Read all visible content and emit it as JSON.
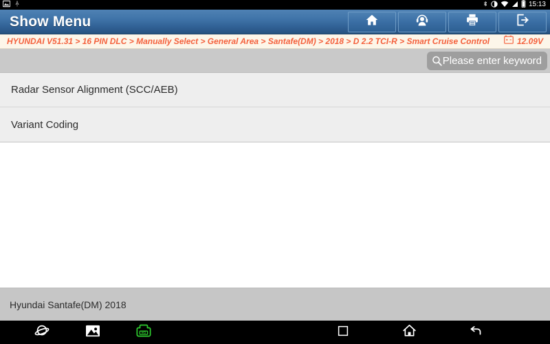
{
  "status_bar": {
    "left_icons": [
      "gallery-icon",
      "usb-icon"
    ],
    "right_icons": [
      "bluetooth-icon",
      "dnd-icon",
      "wifi-icon",
      "signal-icon",
      "battery-icon"
    ],
    "time": "15:13"
  },
  "title_bar": {
    "title": "Show Menu",
    "buttons": [
      {
        "name": "home-button",
        "icon": "home-icon"
      },
      {
        "name": "support-button",
        "icon": "headset-person-icon"
      },
      {
        "name": "print-button",
        "icon": "printer-icon"
      },
      {
        "name": "exit-button",
        "icon": "exit-door-icon"
      }
    ]
  },
  "breadcrumb": {
    "path": "HYUNDAI V51.31 > 16 PIN DLC > Manually Select > General Area > Santafe(DM) > 2018 > D 2.2 TCI-R > Smart Cruise Control",
    "segments": [
      "HYUNDAI V51.31",
      "16 PIN DLC",
      "Manually Select",
      "General Area",
      "Santafe(DM)",
      "2018",
      "D 2.2 TCI-R",
      "Smart Cruise Control"
    ],
    "voltage": "12.09V",
    "voltage_icon": "car-battery-icon"
  },
  "search": {
    "placeholder": "Please enter keyword",
    "value": "",
    "icon": "search-icon"
  },
  "menu": {
    "items": [
      {
        "label": "Radar Sensor Alignment (SCC/AEB)"
      },
      {
        "label": "Variant Coding"
      }
    ]
  },
  "footer": {
    "vehicle": "Hyundai Santafe(DM) 2018"
  },
  "nav_bar": {
    "left_buttons": [
      {
        "name": "browser-button",
        "icon": "planet-icon"
      },
      {
        "name": "gallery-button",
        "icon": "image-icon"
      },
      {
        "name": "vci-button",
        "icon": "vci-connector-icon",
        "label": "VCI"
      }
    ],
    "right_buttons": [
      {
        "name": "recents-button",
        "icon": "square-icon"
      },
      {
        "name": "home-button",
        "icon": "home-outline-icon"
      },
      {
        "name": "back-button",
        "icon": "back-arrow-icon"
      }
    ]
  },
  "colors": {
    "title_bar_blue": "#3a6ea4",
    "breadcrumb_orange": "#f4603c",
    "breadcrumb_bg": "#fdf6e9",
    "search_band_gray": "#c9c9c9",
    "list_item_gray": "#eeeeee",
    "footer_gray": "#c6c6c6",
    "vci_green": "#2ecc2e"
  }
}
